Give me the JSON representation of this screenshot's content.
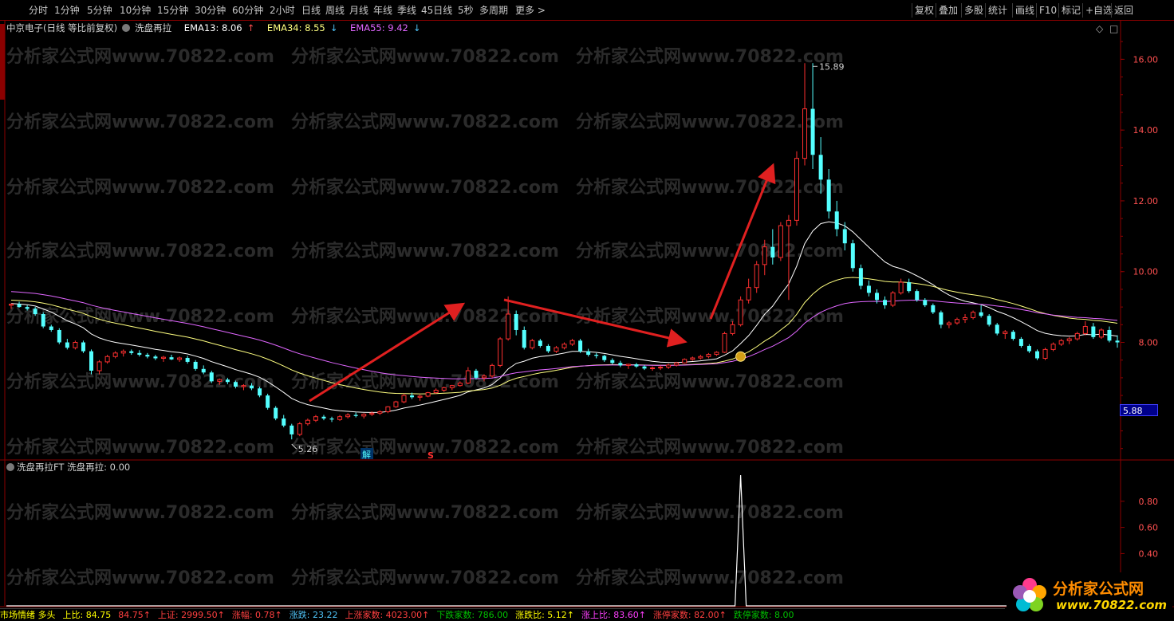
{
  "toolbar": {
    "periods": [
      "分时",
      "1分钟",
      "5分钟",
      "10分钟",
      "15分钟",
      "30分钟",
      "60分钟",
      "2小时",
      "日线",
      "周线",
      "月线",
      "年线",
      "季线",
      "45日线",
      "5秒",
      "多周期",
      "更多 >"
    ],
    "actions": [
      "复权",
      "叠加",
      "多股",
      "统计",
      "画线",
      "F10",
      "标记",
      "+自选",
      "返回"
    ]
  },
  "main_legend": {
    "stock_name": "中京电子(日线 等比前复权)",
    "indicator_name": "洗盘再拉",
    "ema13": "EMA13: 8.06",
    "ema34": "EMA34: 8.55",
    "ema55": "EMA55: 9.42",
    "ema13_color": "#ffffff",
    "ema34_color": "#ffff80",
    "ema55_color": "#e066ff"
  },
  "sub_legend": {
    "indicator": "洗盘再拉FT",
    "value_text": "洗盘再拉: 0.00"
  },
  "annotations": {
    "high_label": "15.89",
    "low_label": "5.26",
    "current_price": "5.88",
    "marker_jie": "解",
    "marker_s": "S"
  },
  "watermark": "分析家公式网www.70822.com",
  "status_bar": {
    "items": [
      {
        "text": "市场情绪 多头",
        "color": "#ffff00"
      },
      {
        "text": "上比: 84.75",
        "color": "#ffff00"
      },
      {
        "text": "84.75↑",
        "color": "#ff4040"
      },
      {
        "text": "上证: 2999.50↑",
        "color": "#ff4040"
      },
      {
        "text": "涨幅: 0.78↑",
        "color": "#ff4040"
      },
      {
        "text": "涨跌: 23.22",
        "color": "#4fc3f7"
      },
      {
        "text": "上涨家数: 4023.00↑",
        "color": "#ff4040"
      },
      {
        "text": "下跌家数: 786.00",
        "color": "#00c000"
      },
      {
        "text": "涨跌比: 5.12↑",
        "color": "#ffff00"
      },
      {
        "text": "涨上比: 83.60↑",
        "color": "#ff40ff"
      },
      {
        "text": "涨停家数: 82.00↑",
        "color": "#ff4040"
      },
      {
        "text": "跌停家数: 8.00",
        "color": "#00c000"
      }
    ]
  },
  "logo": {
    "title": "分析家公式网",
    "url": "www.70822.com"
  },
  "chart_data": [
    {
      "type": "candlestick",
      "title": "",
      "ylim": [
        4.7,
        17.0
      ],
      "yticks": [
        8.0,
        10.0,
        12.0,
        14.0,
        16.0
      ],
      "ytick_labels": [
        "8.00",
        "10.00",
        "12.00",
        "14.00",
        "16.00"
      ],
      "ohlc": [
        [
          9.05,
          9.1,
          8.95,
          9.08
        ],
        [
          9.08,
          9.15,
          8.98,
          9.0
        ],
        [
          9.0,
          9.05,
          8.9,
          8.95
        ],
        [
          8.95,
          9.0,
          8.75,
          8.8
        ],
        [
          8.8,
          8.85,
          8.4,
          8.45
        ],
        [
          8.45,
          8.5,
          8.3,
          8.35
        ],
        [
          8.35,
          8.4,
          7.95,
          8.0
        ],
        [
          8.0,
          8.1,
          7.8,
          7.85
        ],
        [
          7.85,
          8.05,
          7.8,
          8.0
        ],
        [
          8.0,
          8.05,
          7.7,
          7.75
        ],
        [
          7.75,
          7.8,
          7.1,
          7.2
        ],
        [
          7.2,
          7.5,
          7.1,
          7.45
        ],
        [
          7.45,
          7.65,
          7.4,
          7.6
        ],
        [
          7.6,
          7.75,
          7.55,
          7.7
        ],
        [
          7.7,
          7.8,
          7.6,
          7.75
        ],
        [
          7.75,
          7.8,
          7.65,
          7.7
        ],
        [
          7.7,
          7.78,
          7.6,
          7.65
        ],
        [
          7.65,
          7.7,
          7.55,
          7.6
        ],
        [
          7.6,
          7.65,
          7.5,
          7.55
        ],
        [
          7.55,
          7.62,
          7.45,
          7.58
        ],
        [
          7.58,
          7.65,
          7.5,
          7.52
        ],
        [
          7.52,
          7.6,
          7.45,
          7.56
        ],
        [
          7.56,
          7.62,
          7.4,
          7.45
        ],
        [
          7.45,
          7.5,
          7.2,
          7.25
        ],
        [
          7.25,
          7.35,
          7.1,
          7.15
        ],
        [
          7.15,
          7.2,
          6.85,
          6.9
        ],
        [
          6.9,
          6.98,
          6.8,
          6.95
        ],
        [
          6.95,
          7.0,
          6.82,
          6.88
        ],
        [
          6.88,
          6.92,
          6.7,
          6.75
        ],
        [
          6.75,
          6.82,
          6.65,
          6.78
        ],
        [
          6.78,
          6.85,
          6.65,
          6.7
        ],
        [
          6.7,
          6.75,
          6.45,
          6.5
        ],
        [
          6.5,
          6.55,
          6.1,
          6.15
        ],
        [
          6.15,
          6.2,
          5.8,
          5.85
        ],
        [
          5.85,
          5.95,
          5.6,
          5.65
        ],
        [
          5.65,
          5.7,
          5.26,
          5.4
        ],
        [
          5.4,
          5.75,
          5.35,
          5.7
        ],
        [
          5.7,
          5.85,
          5.65,
          5.8
        ],
        [
          5.8,
          5.95,
          5.75,
          5.9
        ],
        [
          5.9,
          5.95,
          5.8,
          5.85
        ],
        [
          5.85,
          5.9,
          5.75,
          5.82
        ],
        [
          5.82,
          5.95,
          5.78,
          5.9
        ],
        [
          5.9,
          6.0,
          5.85,
          5.95
        ],
        [
          5.95,
          6.02,
          5.88,
          5.92
        ],
        [
          5.92,
          6.0,
          5.85,
          5.97
        ],
        [
          5.97,
          6.05,
          5.92,
          6.0
        ],
        [
          6.0,
          6.08,
          5.95,
          6.04
        ],
        [
          6.04,
          6.2,
          6.0,
          6.18
        ],
        [
          6.18,
          6.35,
          6.15,
          6.32
        ],
        [
          6.32,
          6.55,
          6.28,
          6.5
        ],
        [
          6.5,
          6.58,
          6.4,
          6.45
        ],
        [
          6.45,
          6.52,
          6.35,
          6.48
        ],
        [
          6.48,
          6.6,
          6.45,
          6.58
        ],
        [
          6.58,
          6.7,
          6.55,
          6.65
        ],
        [
          6.65,
          6.75,
          6.6,
          6.72
        ],
        [
          6.72,
          6.8,
          6.65,
          6.78
        ],
        [
          6.78,
          6.9,
          6.75,
          6.85
        ],
        [
          6.85,
          7.3,
          6.82,
          7.2
        ],
        [
          7.2,
          7.25,
          6.95,
          7.0
        ],
        [
          7.0,
          7.1,
          6.9,
          7.05
        ],
        [
          7.05,
          7.4,
          7.0,
          7.35
        ],
        [
          7.35,
          8.15,
          7.3,
          8.1
        ],
        [
          8.1,
          9.3,
          8.05,
          8.8
        ],
        [
          8.8,
          8.9,
          8.2,
          8.35
        ],
        [
          8.35,
          8.45,
          7.8,
          7.85
        ],
        [
          7.85,
          8.1,
          7.8,
          8.05
        ],
        [
          8.05,
          8.1,
          7.85,
          7.9
        ],
        [
          7.9,
          7.95,
          7.7,
          7.75
        ],
        [
          7.75,
          7.9,
          7.7,
          7.85
        ],
        [
          7.85,
          8.0,
          7.8,
          7.95
        ],
        [
          7.95,
          8.1,
          7.9,
          8.05
        ],
        [
          8.05,
          8.1,
          7.7,
          7.75
        ],
        [
          7.75,
          7.82,
          7.6,
          7.65
        ],
        [
          7.65,
          7.7,
          7.55,
          7.62
        ],
        [
          7.62,
          7.65,
          7.45,
          7.5
        ],
        [
          7.5,
          7.55,
          7.38,
          7.42
        ],
        [
          7.42,
          7.48,
          7.3,
          7.35
        ],
        [
          7.35,
          7.4,
          7.25,
          7.38
        ],
        [
          7.38,
          7.42,
          7.28,
          7.32
        ],
        [
          7.32,
          7.36,
          7.22,
          7.26
        ],
        [
          7.26,
          7.32,
          7.2,
          7.28
        ],
        [
          7.28,
          7.35,
          7.22,
          7.3
        ],
        [
          7.3,
          7.4,
          7.25,
          7.36
        ],
        [
          7.36,
          7.45,
          7.32,
          7.42
        ],
        [
          7.42,
          7.55,
          7.4,
          7.52
        ],
        [
          7.52,
          7.6,
          7.48,
          7.56
        ],
        [
          7.56,
          7.65,
          7.52,
          7.6
        ],
        [
          7.6,
          7.7,
          7.55,
          7.66
        ],
        [
          7.66,
          7.75,
          7.62,
          7.72
        ],
        [
          7.72,
          8.3,
          7.7,
          8.25
        ],
        [
          8.25,
          8.6,
          8.2,
          8.5
        ],
        [
          8.5,
          9.3,
          8.45,
          9.2
        ],
        [
          9.2,
          9.8,
          9.1,
          9.55
        ],
        [
          9.55,
          10.3,
          9.4,
          10.2
        ],
        [
          10.2,
          10.9,
          9.9,
          10.7
        ],
        [
          10.7,
          11.2,
          10.2,
          10.4
        ],
        [
          10.4,
          11.4,
          10.3,
          11.3
        ],
        [
          11.3,
          11.6,
          9.2,
          11.45
        ],
        [
          11.45,
          13.4,
          11.3,
          13.2
        ],
        [
          13.2,
          15.89,
          13.0,
          14.6
        ],
        [
          14.6,
          15.89,
          12.9,
          13.3
        ],
        [
          13.3,
          13.8,
          12.2,
          12.6
        ],
        [
          12.6,
          12.9,
          11.5,
          11.7
        ],
        [
          11.7,
          12.0,
          11.0,
          11.2
        ],
        [
          11.2,
          11.4,
          10.6,
          10.8
        ],
        [
          10.8,
          10.9,
          10.0,
          10.1
        ],
        [
          10.1,
          10.2,
          9.5,
          9.6
        ],
        [
          9.6,
          9.75,
          9.3,
          9.4
        ],
        [
          9.4,
          9.5,
          9.1,
          9.2
        ],
        [
          9.2,
          9.3,
          8.95,
          9.05
        ],
        [
          9.05,
          9.45,
          9.0,
          9.4
        ],
        [
          9.4,
          9.8,
          9.35,
          9.7
        ],
        [
          9.7,
          9.8,
          9.4,
          9.45
        ],
        [
          9.45,
          9.5,
          9.15,
          9.2
        ],
        [
          9.2,
          9.25,
          9.0,
          9.05
        ],
        [
          9.05,
          9.1,
          8.8,
          8.85
        ],
        [
          8.85,
          8.9,
          8.4,
          8.5
        ],
        [
          8.5,
          8.6,
          8.4,
          8.55
        ],
        [
          8.55,
          8.7,
          8.5,
          8.65
        ],
        [
          8.65,
          8.8,
          8.55,
          8.7
        ],
        [
          8.7,
          8.9,
          8.65,
          8.85
        ],
        [
          8.85,
          9.05,
          8.7,
          8.75
        ],
        [
          8.75,
          8.8,
          8.45,
          8.5
        ],
        [
          8.5,
          8.55,
          8.2,
          8.25
        ],
        [
          8.25,
          8.35,
          8.1,
          8.3
        ],
        [
          8.3,
          8.35,
          8.05,
          8.1
        ],
        [
          8.1,
          8.15,
          7.85,
          7.9
        ],
        [
          7.9,
          7.95,
          7.7,
          7.75
        ],
        [
          7.75,
          7.8,
          7.5,
          7.55
        ],
        [
          7.55,
          7.85,
          7.5,
          7.8
        ],
        [
          7.8,
          8.0,
          7.75,
          7.95
        ],
        [
          7.95,
          8.1,
          7.9,
          8.05
        ],
        [
          8.05,
          8.15,
          7.95,
          8.1
        ],
        [
          8.1,
          8.3,
          8.05,
          8.25
        ],
        [
          8.25,
          8.6,
          8.2,
          8.45
        ],
        [
          8.45,
          8.55,
          8.1,
          8.15
        ],
        [
          8.15,
          8.4,
          8.1,
          8.35
        ],
        [
          8.35,
          8.45,
          8.0,
          8.05
        ],
        [
          8.05,
          8.2,
          7.85,
          8.0
        ]
      ],
      "series": [
        {
          "name": "EMA13",
          "color": "#ffffff"
        },
        {
          "name": "EMA34",
          "color": "#ffff80"
        },
        {
          "name": "EMA55",
          "color": "#e066ff"
        }
      ],
      "annotations": [
        {
          "text": "15.89",
          "at_index": 100,
          "value": 15.89
        },
        {
          "text": "5.26",
          "at_index": 35,
          "value": 5.26
        }
      ]
    },
    {
      "type": "line",
      "title": "",
      "series": [
        {
          "name": "洗盘再拉",
          "color": "#ffffff"
        }
      ],
      "ylim": [
        0,
        1.0
      ],
      "yticks": [
        0.4,
        0.6,
        0.8
      ],
      "ytick_labels": [
        "0.40",
        "0.60",
        "0.80"
      ],
      "spike_index": 91,
      "spike_value": 1.0
    }
  ]
}
